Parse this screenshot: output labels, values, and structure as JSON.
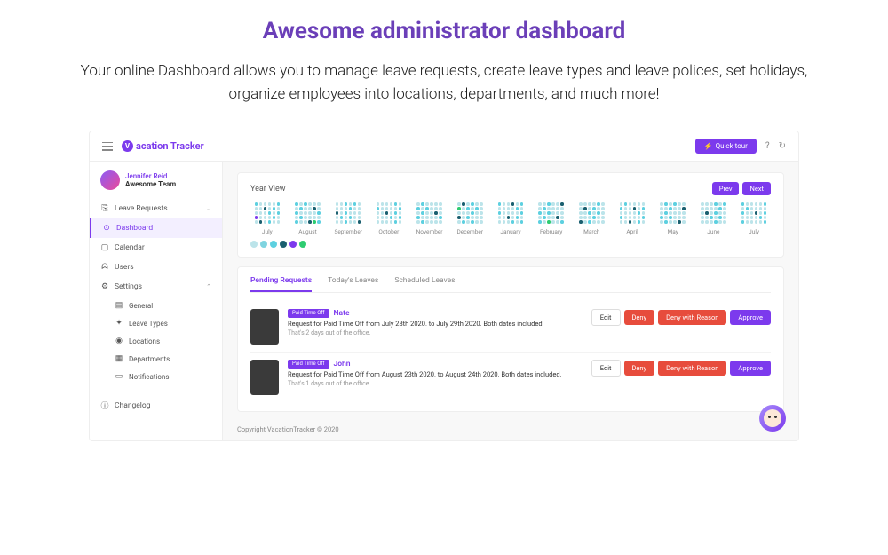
{
  "hero": {
    "title": "Awesome administrator dashboard",
    "subtitle": "Your online Dashboard allows you to manage leave requests, create leave types and leave polices, set holidays, organize employees into locations, departments, and much more!"
  },
  "app": {
    "brand": "acation Tracker",
    "brand_mark": "V",
    "quick_tour": "Quick tour",
    "user": {
      "name": "Jennifer Reid",
      "team": "Awesome Team"
    },
    "nav": {
      "leave_requests": "Leave Requests",
      "dashboard": "Dashboard",
      "calendar": "Calendar",
      "users": "Users",
      "settings": "Settings",
      "general": "General",
      "leave_types": "Leave Types",
      "locations": "Locations",
      "departments": "Departments",
      "notifications": "Notifications",
      "changelog": "Changelog"
    },
    "year_view": {
      "title": "Year View",
      "prev": "Prev",
      "next": "Next",
      "months": [
        "July",
        "August",
        "September",
        "October",
        "November",
        "December",
        "January",
        "February",
        "March",
        "April",
        "May",
        "June",
        "July"
      ]
    },
    "tabs": {
      "pending": "Pending Requests",
      "today": "Today's Leaves",
      "scheduled": "Scheduled Leaves"
    },
    "requests": [
      {
        "badge": "Paid Time Off",
        "name": "Nate",
        "desc": "Request for Paid Time Off from  July 28th 2020. to July 29th 2020. Both dates included.",
        "note": "That's 2 days out of the office."
      },
      {
        "badge": "Paid Time Off",
        "name": "John",
        "desc": "Request for Paid Time Off from  August 23th 2020. to August 24th 2020. Both dates included.",
        "note": "That's 1 days out of the office."
      }
    ],
    "actions": {
      "edit": "Edit",
      "deny": "Deny",
      "deny_reason": "Deny with Reason",
      "approve": "Approve"
    },
    "footer": "Copyright VacationTracker © 2020"
  }
}
